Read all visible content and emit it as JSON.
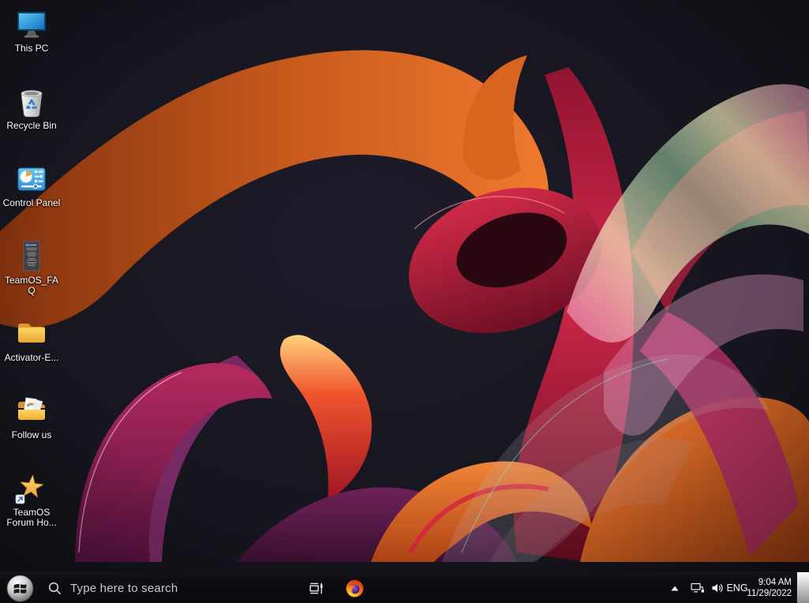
{
  "desktop": {
    "icons": [
      {
        "label": "This PC",
        "icon": "computer-monitor"
      },
      {
        "label": "Recycle Bin",
        "icon": "recycle-bin"
      },
      {
        "label": "Control Panel",
        "icon": "control-panel"
      },
      {
        "label": "TeamOS_FAQ",
        "icon": "text-document"
      },
      {
        "label": "Activator-E...",
        "icon": "folder"
      },
      {
        "label": "Follow us",
        "icon": "folder-with-files"
      },
      {
        "label": "TeamOS Forum Ho...",
        "icon": "star-shortcut"
      }
    ]
  },
  "taskbar": {
    "start": {
      "icon": "windows-logo"
    },
    "search": {
      "placeholder": "Type here to search",
      "icon": "search-magnifier"
    },
    "buttons": [
      {
        "icon": "task-view"
      },
      {
        "icon": "firefox"
      }
    ],
    "tray": {
      "expand_icon": "chevron-up",
      "network_icon": "ethernet-network",
      "volume_icon": "speaker-volume",
      "language": "ENG",
      "clock": {
        "time": "9:04 AM",
        "date": "11/29/2022"
      }
    }
  },
  "colors": {
    "desktop_bg": "#17161f",
    "taskbar_bg": "#0b0a0f",
    "icon_label_text": "#ffffff",
    "search_text": "#c9c9c9",
    "tray_text": "#ffffff",
    "wallpaper_orange": "#e96f28",
    "wallpaper_red": "#c62240",
    "wallpaper_magenta": "#b62a5e",
    "wallpaper_purple": "#7c2a68",
    "wallpaper_iridescent_pink": "#e571a8",
    "wallpaper_iridescent_green": "#9fd6a8",
    "folder_yellow": "#f5c14e",
    "star_gold": "#f6c04a",
    "monitor_blue": "#2e9fe0",
    "control_panel_blue": "#3fa9e8",
    "recycle_arrows_blue": "#2f7fd0",
    "firefox_orange": "#ff7a1c",
    "firefox_purple": "#5b3cc4"
  }
}
